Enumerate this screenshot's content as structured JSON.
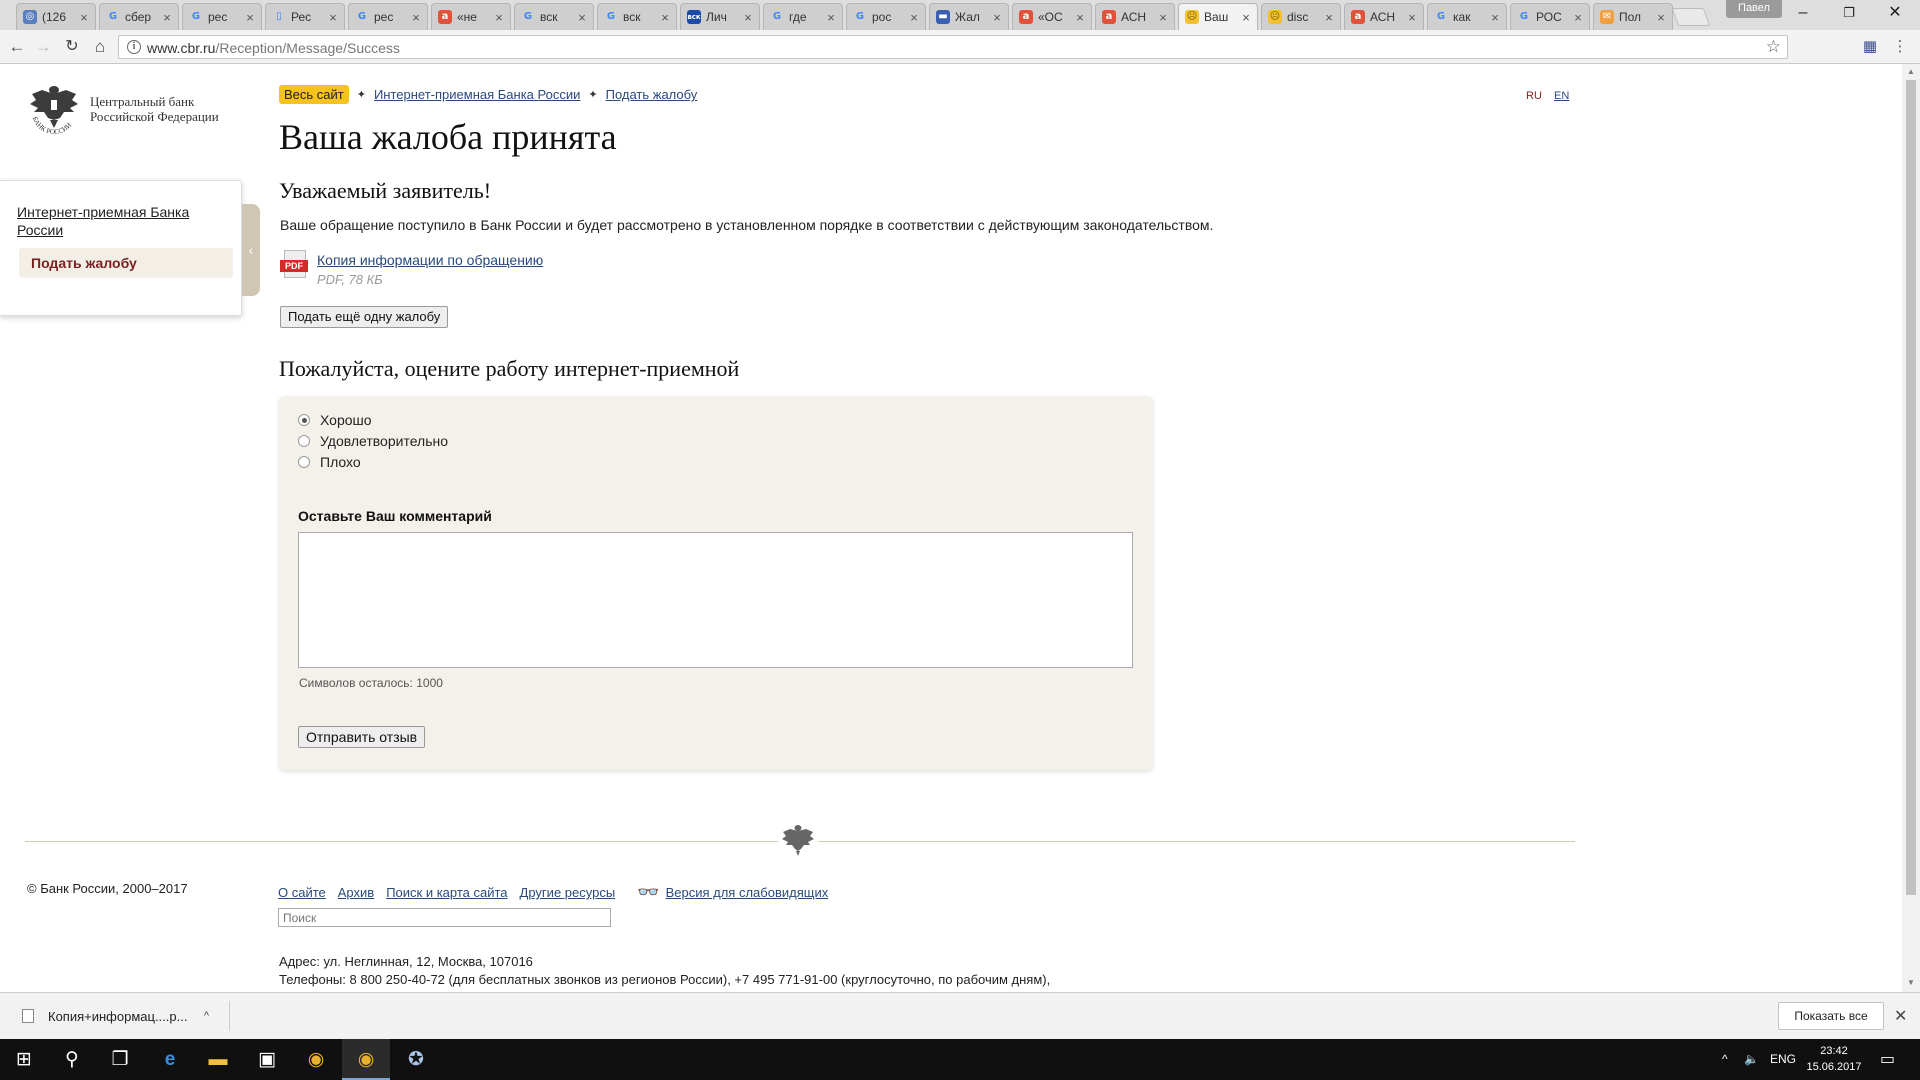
{
  "browser": {
    "tabs": [
      {
        "title": "(126",
        "icon": "app-icon",
        "color": "#5a7fc0",
        "glyph": "◎"
      },
      {
        "title": "сбер",
        "icon": "google-icon",
        "color": "#ffffff",
        "glyph": "G"
      },
      {
        "title": "рес",
        "icon": "google-icon",
        "color": "#ffffff",
        "glyph": "G"
      },
      {
        "title": "Рес",
        "icon": "document-icon",
        "color": "#ffffff",
        "glyph": "▯"
      },
      {
        "title": "рес",
        "icon": "google-icon",
        "color": "#ffffff",
        "glyph": "G"
      },
      {
        "title": "«не",
        "icon": "letter-a-icon",
        "color": "#e2513a",
        "glyph": "a"
      },
      {
        "title": "вск",
        "icon": "google-icon",
        "color": "#ffffff",
        "glyph": "G"
      },
      {
        "title": "вск",
        "icon": "google-icon",
        "color": "#ffffff",
        "glyph": "G"
      },
      {
        "title": "Лич",
        "icon": "vsk-icon",
        "color": "#1b4aa8",
        "glyph": "вск"
      },
      {
        "title": "где",
        "icon": "google-icon",
        "color": "#ffffff",
        "glyph": "G"
      },
      {
        "title": "рос",
        "icon": "google-icon",
        "color": "#ffffff",
        "glyph": "G"
      },
      {
        "title": "Жал",
        "icon": "flag-icon",
        "color": "#3a5fb0",
        "glyph": "▬"
      },
      {
        "title": "«ОС",
        "icon": "letter-a-icon",
        "color": "#e2513a",
        "glyph": "a"
      },
      {
        "title": "АСН",
        "icon": "letter-a-icon",
        "color": "#e2513a",
        "glyph": "a"
      },
      {
        "title": "Ваш",
        "icon": "sad-face-icon",
        "color": "#f2c12e",
        "glyph": "☹",
        "active": true
      },
      {
        "title": "disc",
        "icon": "sad-face-icon",
        "color": "#f2c12e",
        "glyph": "☹"
      },
      {
        "title": "АСН",
        "icon": "letter-a-icon",
        "color": "#e2513a",
        "glyph": "a"
      },
      {
        "title": "как",
        "icon": "google-icon",
        "color": "#ffffff",
        "glyph": "G"
      },
      {
        "title": "РОС",
        "icon": "google-icon",
        "color": "#ffffff",
        "glyph": "G"
      },
      {
        "title": "Пол",
        "icon": "post-icon",
        "color": "#f0a040",
        "glyph": "✉"
      }
    ],
    "profile": "Павел",
    "url_host": "www.cbr.ru",
    "url_path": "/Reception/Message/Success"
  },
  "site": {
    "logo_line1": "Центральный банк",
    "logo_line2": "Российской Федерации",
    "logo_ring": "БАНК РОССИИ",
    "lang_ru": "RU",
    "lang_en": "EN"
  },
  "sidebar": {
    "link": "Интернет-приемная Банка России",
    "active": "Подать жалобу"
  },
  "breadcrumbs": {
    "first": "Весь сайт",
    "second": "Интернет-приемная Банка России",
    "third": "Подать жалобу",
    "separator": "✦"
  },
  "main": {
    "title": "Ваша жалоба принята",
    "greeting": "Уважаемый заявитель!",
    "message": "Ваше обращение поступило в Банк России и будет рассмотрено в установленном порядке в соответствии с действующим законодательством.",
    "file_badge": "PDF",
    "file_link": "Копия информации по обращению",
    "file_meta": "PDF, 78 КБ",
    "again_button": "Подать ещё одну жалобу"
  },
  "feedback": {
    "title": "Пожалуйста, оцените работу интернет-приемной",
    "options": [
      {
        "label": "Хорошо",
        "checked": true
      },
      {
        "label": "Удовлетворительно",
        "checked": false
      },
      {
        "label": "Плохо",
        "checked": false
      }
    ],
    "comment_label": "Оставьте Ваш комментарий",
    "comment_value": "",
    "counter": "Символов осталось: 1000",
    "submit": "Отправить отзыв"
  },
  "footer": {
    "copyright": "© Банк России, 2000–2017",
    "links": [
      "О сайте",
      "Архив",
      "Поиск и карта сайта",
      "Другие ресурсы"
    ],
    "accessibility": "Версия для слабовидящих",
    "search_placeholder": "Поиск",
    "address": "Адрес: ул. Неглинная, 12, Москва, 107016",
    "phones": "Телефоны: 8 800 250-40-72 (для бесплатных звонков из регионов России), +7 495 771-91-00 (круглосуточно, по рабочим дням),"
  },
  "downloads": {
    "file": "Копия+информац....p...",
    "show_all": "Показать все"
  },
  "taskbar": {
    "lang": "ENG",
    "time": "23:42",
    "date": "15.06.2017"
  },
  "colors": {
    "accent_yellow": "#f6c31c",
    "active_menu_text": "#7a1f1f",
    "panel_bg": "#f4f1ea",
    "link": "#2a4a7a"
  }
}
